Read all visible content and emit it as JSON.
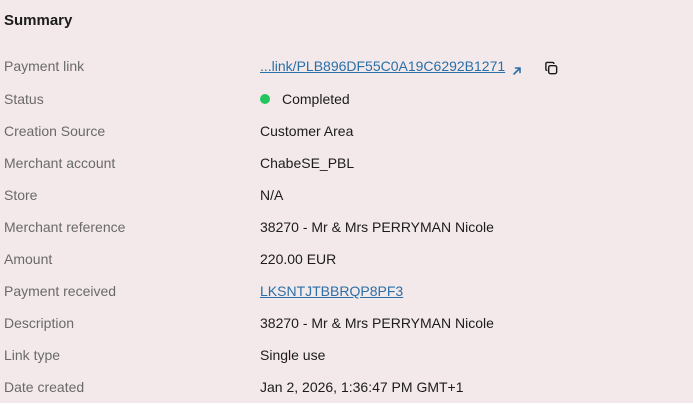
{
  "summary": {
    "title": "Summary",
    "rows": {
      "payment_link": {
        "label": "Payment link",
        "value": "...link/PLB896DF55C0A19C6292B1271"
      },
      "status": {
        "label": "Status",
        "value": "Completed",
        "dot_color": "#22c55e"
      },
      "creation_source": {
        "label": "Creation Source",
        "value": "Customer Area"
      },
      "merchant_account": {
        "label": "Merchant account",
        "value": "ChabeSE_PBL"
      },
      "store": {
        "label": "Store",
        "value": "N/A"
      },
      "merchant_reference": {
        "label": "Merchant reference",
        "value": "38270 - Mr & Mrs PERRYMAN Nicole"
      },
      "amount": {
        "label": "Amount",
        "value": "220.00 EUR"
      },
      "payment_received": {
        "label": "Payment received",
        "value": "LKSNTJTBBRQP8PF3"
      },
      "description": {
        "label": "Description",
        "value": "38270 - Mr & Mrs PERRYMAN Nicole"
      },
      "link_type": {
        "label": "Link type",
        "value": "Single use"
      },
      "date_created": {
        "label": "Date created",
        "value": "Jan 2, 2026, 1:36:47 PM GMT+1"
      }
    },
    "icons": {
      "external_link": "external-link-icon",
      "copy": "copy-icon"
    },
    "colors": {
      "link": "#2a6fa8",
      "label": "#6a6a6a",
      "background": "#f3e9ea"
    }
  }
}
